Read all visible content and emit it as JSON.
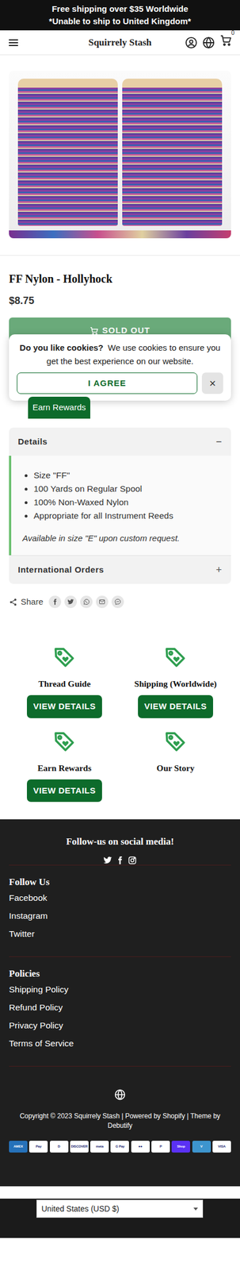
{
  "announcement": [
    "Free shipping over $35 Worldwide",
    "*Unable to ship to United Kingdom*"
  ],
  "header": {
    "brand": "Squirrely Stash",
    "cart_count": "0"
  },
  "product": {
    "title": "FF Nylon - Hollyhock",
    "price": "$8.75",
    "button": "SOLD OUT",
    "disabled": true
  },
  "cookie_banner": {
    "title": "Do you like cookies?",
    "text": "We use cookies to ensure you get the best experience on our website.",
    "agree": "I AGREE",
    "close": "×"
  },
  "rewards_tab": "Earn Rewards",
  "accordion": [
    {
      "title": "Details",
      "expanded": true,
      "icon": "−",
      "items": [
        "Size \"FF\"",
        "100 Yards on Regular Spool",
        "100% Non-Waxed Nylon",
        "Appropriate for all Instrument Reeds"
      ],
      "note": "Available in size \"E\" upon custom request."
    },
    {
      "title": "International Orders",
      "expanded": false,
      "icon": "+"
    }
  ],
  "share": {
    "label": "Share",
    "networks": [
      {
        "kind": "facebook"
      },
      {
        "kind": "twitter"
      },
      {
        "kind": "whatsapp"
      },
      {
        "kind": "email"
      },
      {
        "kind": "messenger"
      }
    ]
  },
  "features": [
    {
      "title": "Thread Guide",
      "button": "VIEW DETAILS"
    },
    {
      "title": "Shipping (Worldwide)",
      "button": "VIEW DETAILS"
    },
    {
      "title": "Earn Rewards",
      "button": "VIEW DETAILS"
    },
    {
      "title": "Our Story"
    }
  ],
  "footer": {
    "social_title": "Follow-us on social media!",
    "social": [
      {
        "kind": "twitter"
      },
      {
        "kind": "facebook"
      },
      {
        "kind": "instagram"
      }
    ],
    "menus": [
      {
        "title": "Follow Us",
        "links": [
          "Facebook",
          "Instagram",
          "Twitter"
        ]
      },
      {
        "title": "Policies",
        "links": [
          "Shipping Policy",
          "Refund Policy",
          "Privacy Policy",
          "Terms of Service"
        ]
      }
    ],
    "copyright": "Copyright © 2023 Squirrely Stash | Powered by Shopify | Theme by Debutify",
    "payments": [
      {
        "label": "AMEX",
        "color": "#2671b9"
      },
      {
        "label": "Pay",
        "color": "#ffffff"
      },
      {
        "label": "D",
        "color": "#ffffff"
      },
      {
        "label": "DISCOVER",
        "color": "#ffffff"
      },
      {
        "label": "meta",
        "color": "#ffffff"
      },
      {
        "label": "G Pay",
        "color": "#ffffff"
      },
      {
        "label": "●●",
        "color": "#ffffff"
      },
      {
        "label": "P",
        "color": "#ffffff"
      },
      {
        "label": "Shop",
        "color": "#5a31f4"
      },
      {
        "label": "V",
        "color": "#3d95ce"
      },
      {
        "label": "VISA",
        "color": "#ffffff"
      }
    ],
    "currency": "United States (USD $)"
  }
}
